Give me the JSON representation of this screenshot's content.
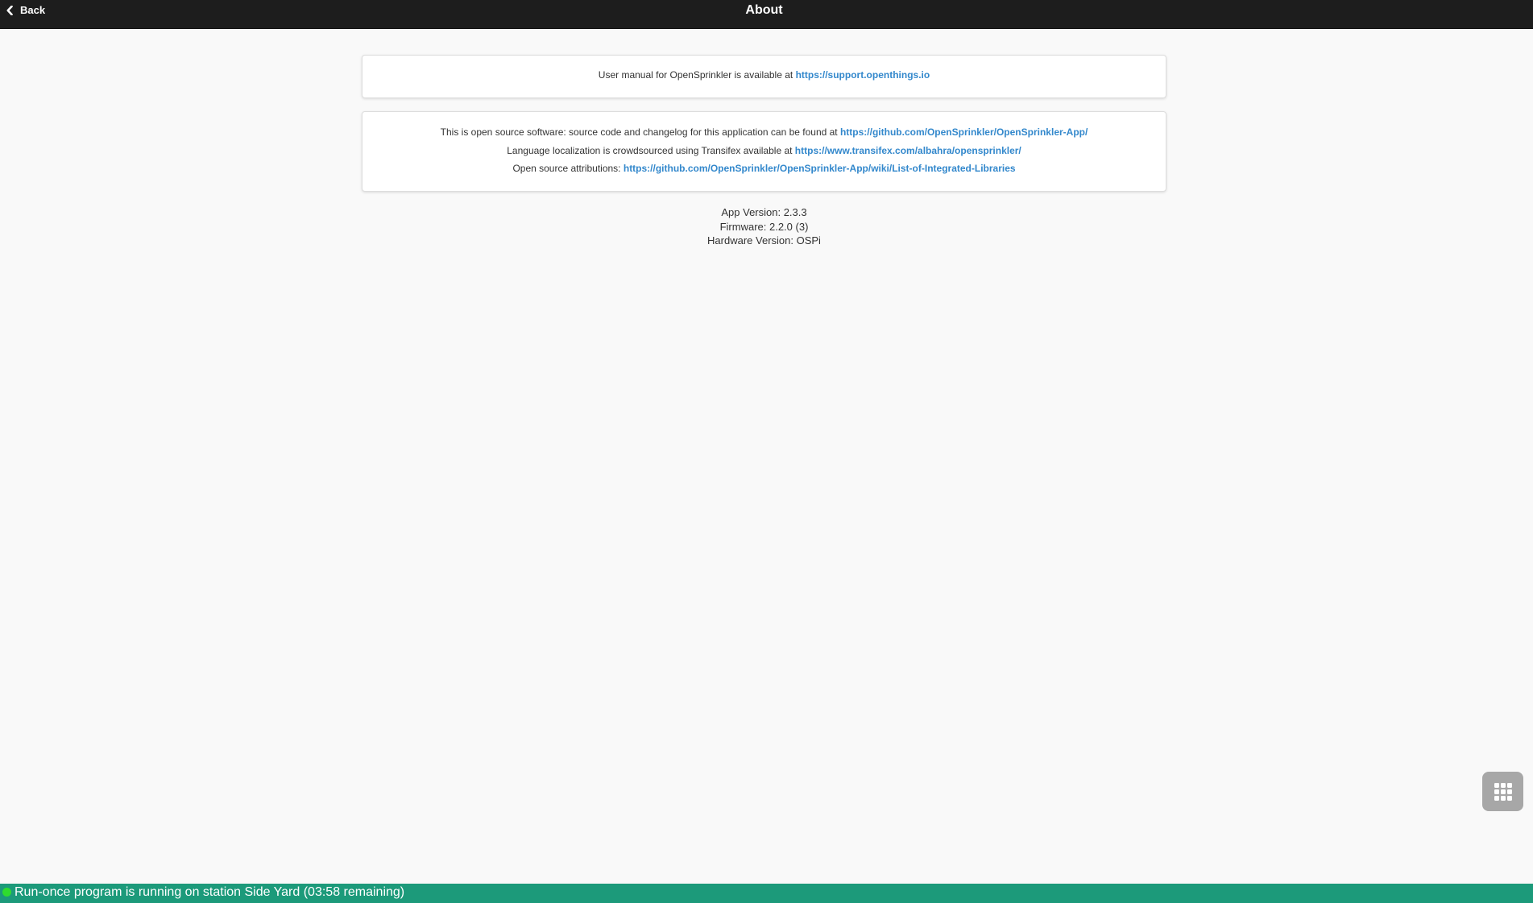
{
  "header": {
    "back_label": "Back",
    "title": "About"
  },
  "manual_card": {
    "text": "User manual for OpenSprinkler is available at ",
    "link": "https://support.openthings.io"
  },
  "opensource_card": {
    "lines": [
      {
        "text": "This is open source software: source code and changelog for this application can be found at ",
        "link": "https://github.com/OpenSprinkler/OpenSprinkler-App/"
      },
      {
        "text": "Language localization is crowdsourced using Transifex available at ",
        "link": "https://www.transifex.com/albahra/opensprinkler/"
      },
      {
        "text": "Open source attributions: ",
        "link": "https://github.com/OpenSprinkler/OpenSprinkler-App/wiki/List-of-Integrated-Libraries"
      }
    ]
  },
  "versions": {
    "app_version": "App Version: 2.3.3",
    "firmware": "Firmware: 2.2.0 (3)",
    "hardware": "Hardware Version: OSPi"
  },
  "status_bar": {
    "text": "Run-once program is running on station Side Yard (03:58 remaining)",
    "dot_color": "#2fdc2f",
    "background_color": "#1c9a7a"
  },
  "icons": {
    "back": "chevron-left-icon",
    "menu": "grid-icon"
  },
  "colors": {
    "header_background": "#1d1d1d",
    "link": "#3388cc",
    "page_background": "#f9f9f9"
  }
}
